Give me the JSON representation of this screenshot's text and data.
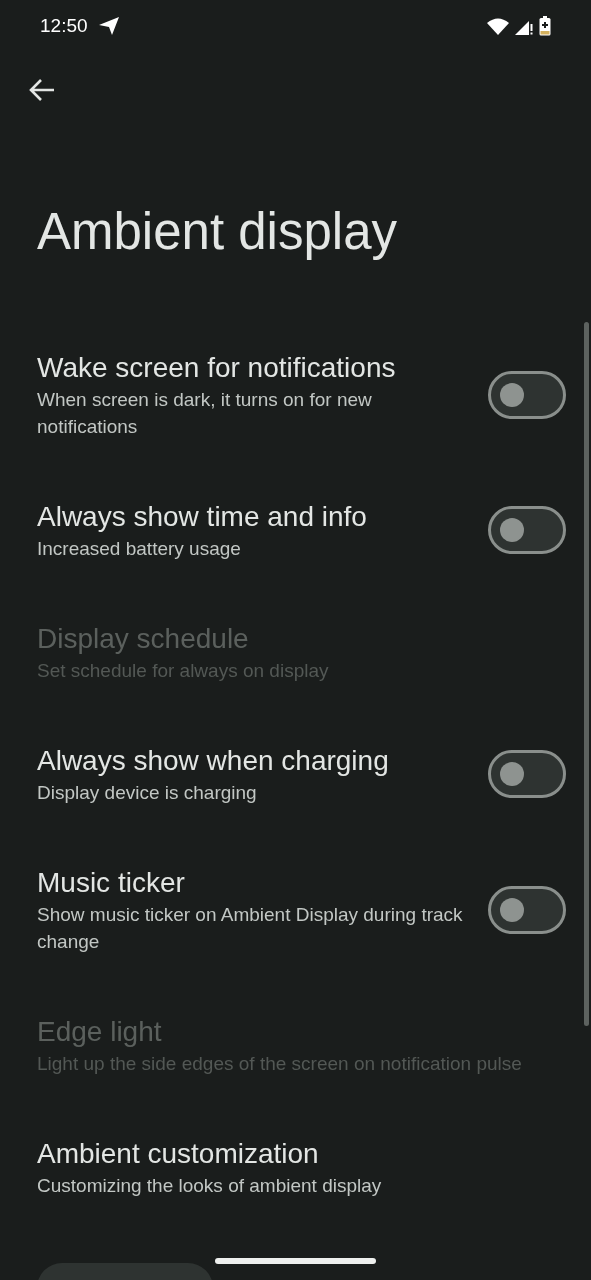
{
  "status_bar": {
    "time": "12:50"
  },
  "title": "Ambient display",
  "settings": [
    {
      "kind": "toggle",
      "title": "Wake screen for notifications",
      "summary": "When screen is dark, it turns on for new notifications",
      "disabled": false,
      "on": false
    },
    {
      "kind": "toggle",
      "title": "Always show time and info",
      "summary": "Increased battery usage",
      "disabled": false,
      "on": false
    },
    {
      "kind": "plain",
      "title": "Display schedule",
      "summary": "Set schedule for always on display",
      "disabled": true
    },
    {
      "kind": "toggle",
      "title": "Always show when charging",
      "summary": "Display device is charging",
      "disabled": false,
      "on": false
    },
    {
      "kind": "toggle",
      "title": "Music ticker",
      "summary": "Show music ticker on Ambient Display during track change",
      "disabled": false,
      "on": false
    },
    {
      "kind": "plain",
      "title": "Edge light",
      "summary": "Light up the side edges of the screen on notification pulse",
      "disabled": true
    },
    {
      "kind": "plain",
      "title": "Ambient customization",
      "summary": "Customizing the looks of ambient display",
      "disabled": false
    }
  ]
}
